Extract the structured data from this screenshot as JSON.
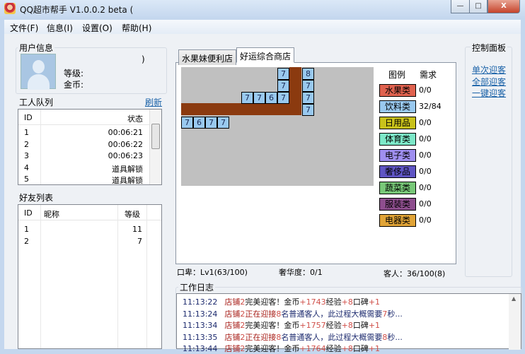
{
  "window": {
    "title": "QQ超市帮手 V1.0.0.2 beta (",
    "minimize": "—",
    "maximize": "□",
    "close": "X"
  },
  "menu": [
    "文件(F)",
    "信息(I)",
    "设置(O)",
    "帮助(H)"
  ],
  "user_info": {
    "title": "用户信息",
    "name_suffix": ")",
    "level_label": "等级:",
    "gold_label": "金币:"
  },
  "worker_queue": {
    "title": "工人队列",
    "refresh": "刷新",
    "columns": [
      "ID",
      "状态"
    ],
    "rows": [
      [
        "1",
        "00:06:21"
      ],
      [
        "2",
        "00:06:22"
      ],
      [
        "3",
        "00:06:23"
      ],
      [
        "4",
        "道具解锁"
      ],
      [
        "5",
        "道具解锁"
      ]
    ]
  },
  "friends": {
    "title": "好友列表",
    "columns": [
      "ID",
      "昵称",
      "等级"
    ],
    "rows": [
      [
        "1",
        "",
        "11"
      ],
      [
        "2",
        "",
        "7"
      ]
    ]
  },
  "tabs": [
    "水果妹便利店",
    "好运综合商店"
  ],
  "active_tab": 1,
  "shelves": [
    "7",
    "8",
    "7",
    "7",
    "7",
    "7",
    "6",
    "7",
    "7",
    "7",
    "7",
    "6",
    "7",
    "7"
  ],
  "legend": {
    "title": "图例",
    "need_title": "需求",
    "items": [
      {
        "label": "水果类",
        "need": "0/0",
        "color": "#e0624f"
      },
      {
        "label": "饮料类",
        "need": "32/84",
        "color": "#99c9ef"
      },
      {
        "label": "日用品",
        "need": "0/0",
        "color": "#c9c21a"
      },
      {
        "label": "体育类",
        "need": "0/0",
        "color": "#7de8c8"
      },
      {
        "label": "电子类",
        "need": "0/0",
        "color": "#9f8ff0"
      },
      {
        "label": "奢侈品",
        "need": "0/0",
        "color": "#5f55c4"
      },
      {
        "label": "蔬菜类",
        "need": "0/0",
        "color": "#78c878"
      },
      {
        "label": "服装类",
        "need": "0/0",
        "color": "#8e4e8e"
      },
      {
        "label": "电器类",
        "need": "0/0",
        "color": "#e1a437"
      }
    ]
  },
  "status": {
    "reputation": "口卑：Lv1(63/100)",
    "luxury": "奢华度：0/1",
    "customers": "客人：36/100(8)"
  },
  "control": {
    "title": "控制面板",
    "links": [
      "单次迎客",
      "全部迎客",
      "一键迎客"
    ]
  },
  "log": {
    "title": "工作日志",
    "lines": [
      {
        "time": "11:13:22",
        "segs": [
          [
            "店铺",
            "r"
          ],
          [
            "2",
            "l"
          ],
          [
            "完美迎客！金币",
            "k"
          ],
          [
            "+1743",
            "l"
          ],
          [
            "经验",
            "k"
          ],
          [
            "+8",
            "l"
          ],
          [
            "口碑",
            "k"
          ],
          [
            "+1",
            "l"
          ]
        ]
      },
      {
        "time": "11:13:24",
        "segs": [
          [
            "店铺",
            "r"
          ],
          [
            "2",
            "l"
          ],
          [
            "正在迎接",
            "r"
          ],
          [
            "8",
            "l"
          ],
          [
            "名普通客人，此过程大概需要",
            "n"
          ],
          [
            "7",
            "l"
          ],
          [
            "秒...",
            "n"
          ]
        ]
      },
      {
        "time": "11:13:34",
        "segs": [
          [
            "店铺",
            "r"
          ],
          [
            "2",
            "l"
          ],
          [
            "完美迎客！金币",
            "k"
          ],
          [
            "+1757",
            "l"
          ],
          [
            "经验",
            "k"
          ],
          [
            "+8",
            "l"
          ],
          [
            "口碑",
            "k"
          ],
          [
            "+1",
            "l"
          ]
        ]
      },
      {
        "time": "11:13:35",
        "segs": [
          [
            "店铺",
            "r"
          ],
          [
            "2",
            "l"
          ],
          [
            "正在迎接",
            "r"
          ],
          [
            "8",
            "l"
          ],
          [
            "名普通客人，此过程大概需要",
            "n"
          ],
          [
            "8",
            "l"
          ],
          [
            "秒...",
            "n"
          ]
        ]
      },
      {
        "time": "11:13:44",
        "segs": [
          [
            "店铺",
            "r"
          ],
          [
            "2",
            "l"
          ],
          [
            "完美迎客！金币",
            "k"
          ],
          [
            "+1764",
            "l"
          ],
          [
            "经验",
            "k"
          ],
          [
            "+8",
            "l"
          ],
          [
            "口碑",
            "k"
          ],
          [
            "+1",
            "l"
          ]
        ]
      }
    ]
  }
}
